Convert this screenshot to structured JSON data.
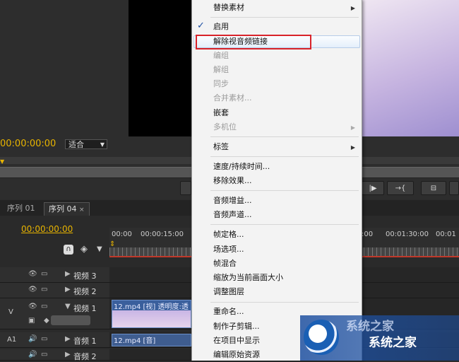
{
  "monitor": {
    "timecode": "00:00:00:00",
    "fit_label": "适合"
  },
  "timeline": {
    "tabs": [
      {
        "label": "序列 01"
      },
      {
        "label": "序列 04"
      }
    ],
    "tab_close": "×",
    "timecode": "00:00:00:00",
    "ruler_ticks": [
      "00:00",
      "00:00:15:00",
      ":00",
      "00:01:30:00",
      "00:01"
    ],
    "tracks": [
      {
        "label": "",
        "name": "视频 3"
      },
      {
        "label": "",
        "name": "视频 2"
      },
      {
        "label": "V",
        "name": "视频 1"
      },
      {
        "label": "A1",
        "name": "音频 1"
      },
      {
        "label": "",
        "name": "音频 2"
      }
    ],
    "clips": {
      "video": "12.mp4 [视] 透明度:透",
      "audio": "12.mp4 [音]"
    }
  },
  "context_menu": {
    "items": [
      {
        "label": "替换素材",
        "disabled": false,
        "submenu": true
      },
      {
        "label": "启用",
        "disabled": false,
        "checked": true
      },
      {
        "label": "解除视音频链接",
        "disabled": false
      },
      {
        "label": "编组",
        "disabled": true
      },
      {
        "label": "解组",
        "disabled": true
      },
      {
        "label": "同步",
        "disabled": true
      },
      {
        "label": "合并素材...",
        "disabled": true
      },
      {
        "label": "嵌套",
        "disabled": false
      },
      {
        "label": "多机位",
        "disabled": true,
        "submenu": true
      },
      {
        "label": "标签",
        "disabled": false,
        "submenu": true
      },
      {
        "label": "速度/持续时间...",
        "disabled": false
      },
      {
        "label": "移除效果...",
        "disabled": false
      },
      {
        "label": "音频增益...",
        "disabled": false
      },
      {
        "label": "音频声道...",
        "disabled": false
      },
      {
        "label": "帧定格...",
        "disabled": false
      },
      {
        "label": "场选项...",
        "disabled": false
      },
      {
        "label": "帧混合",
        "disabled": false
      },
      {
        "label": "缩放为当前画面大小",
        "disabled": false
      },
      {
        "label": "调整图层",
        "disabled": false
      },
      {
        "label": "重命名...",
        "disabled": false
      },
      {
        "label": "制作子剪辑...",
        "disabled": false
      },
      {
        "label": "在项目中显示",
        "disabled": false
      },
      {
        "label": "编辑原始资源",
        "disabled": false
      }
    ]
  },
  "watermark": {
    "text": "系统之家",
    "top_text": "系统之家"
  },
  "colors": {
    "timecode": "#e8b400",
    "highlight": "#d8232a",
    "menu_bg": "#f3f3f3"
  }
}
